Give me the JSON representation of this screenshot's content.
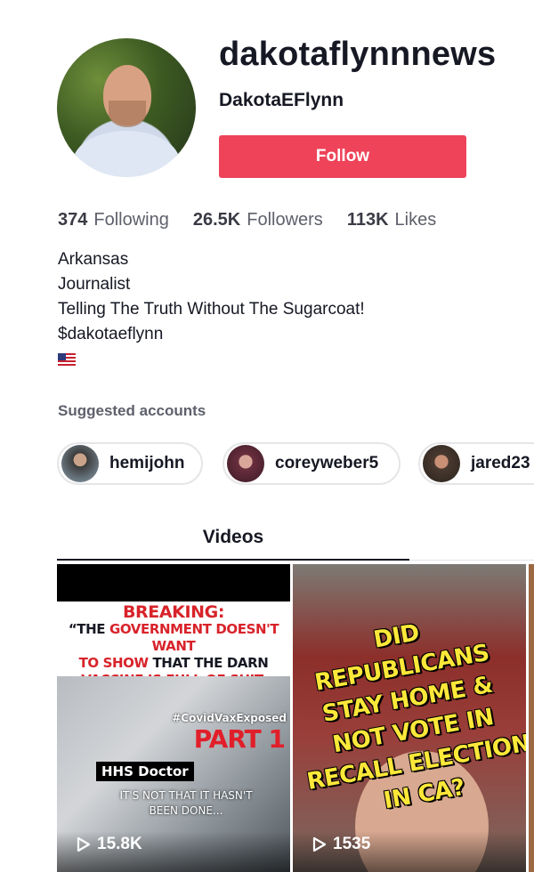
{
  "profile": {
    "username": "dakotaflynnnews",
    "nickname": "DakotaEFlynn",
    "follow_label": "Follow"
  },
  "stats": {
    "following": {
      "value": "374",
      "label": "Following"
    },
    "followers": {
      "value": "26.5K",
      "label": "Followers"
    },
    "likes": {
      "value": "113K",
      "label": "Likes"
    }
  },
  "bio": [
    "Arkansas",
    "Journalist",
    "Telling The Truth Without The Sugarcoat!",
    "$dakotaeflynn"
  ],
  "bio_flag_icon": "us-flag-icon",
  "suggested": {
    "title": "Suggested accounts",
    "accounts": [
      "hemijohn",
      "coreyweber5",
      "jared23"
    ]
  },
  "tabs": {
    "videos": "Videos"
  },
  "videos": [
    {
      "views": "15.8K",
      "overlay": {
        "line1": "BREAKING:",
        "line2a": "“THE ",
        "line2b": "GOVERNMENT DOESN'T WANT",
        "line3a": "TO SHOW",
        "line3b": " THAT THE DARN",
        "line4": "VACCINE IS FULL OF SHIT.",
        "tag": "#CovidVaxExposed",
        "part": "PART 1",
        "caption_box": "HHS Doctor",
        "caption_sub": "IT'S NOT THAT IT HASN'T BEEN DONE..."
      }
    },
    {
      "views": "1535",
      "overlay": {
        "text": "DID REPUBLICANS STAY HOME & NOT VOTE IN RECALL ELECTION IN CA?"
      }
    }
  ],
  "colors": {
    "follow_button": "#ee4359",
    "headline_red": "#d8232a",
    "overlay_yellow": "#fde83a"
  }
}
